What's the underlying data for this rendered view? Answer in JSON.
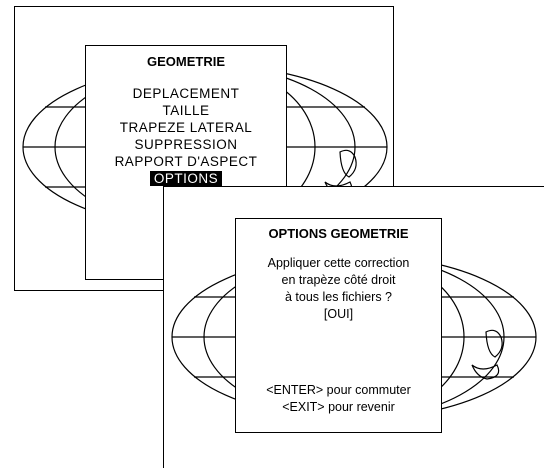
{
  "screen1": {
    "menu": {
      "title": "GEOMETRIE",
      "items": [
        {
          "label": "DEPLACEMENT",
          "selected": false
        },
        {
          "label": "TAILLE",
          "selected": false
        },
        {
          "label": "TRAPEZE LATERAL",
          "selected": false
        },
        {
          "label": "SUPPRESSION",
          "selected": false
        },
        {
          "label": "RAPPORT D'ASPECT",
          "selected": false
        },
        {
          "label": "OPTIONS",
          "selected": true
        }
      ]
    }
  },
  "screen2": {
    "menu": {
      "title": "OPTIONS GEOMETRIE",
      "message": [
        "Appliquer cette correction",
        "en trapèze côté droit",
        "à tous les fichiers ?"
      ],
      "value": "[OUI]",
      "hints": [
        "<ENTER> pour commuter",
        "<EXIT> pour revenir"
      ]
    }
  }
}
